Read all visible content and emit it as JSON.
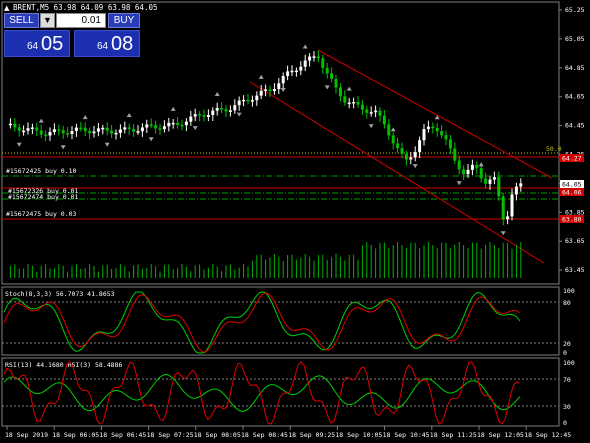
{
  "header": {
    "symbol_line": "BRENT,M5  63.98 64.09 63.98 64.05"
  },
  "trade_panel": {
    "sell_label": "SELL",
    "buy_label": "BUY",
    "lot_value": "0.01",
    "step_symbol": "▼",
    "sell_price_small": "64",
    "sell_price_big": "05",
    "buy_price_small": "64",
    "buy_price_big": "08"
  },
  "orders": [
    {
      "label": "#15672425 buy 0.10"
    },
    {
      "label": "#15672326 buy 0.01"
    },
    {
      "label": "#15672474 buy 0.01"
    },
    {
      "label": "#15672475 buy 0.03"
    }
  ],
  "levels": {
    "fib_label": "50.0",
    "tag_1": "64.27",
    "tag_2": "64.05",
    "tag_3": "64.06",
    "tag_4": "63.80"
  },
  "price_axis": [
    "65.25",
    "65.05",
    "64.85",
    "64.65",
    "64.45",
    "64.25",
    "64.05",
    "63.85",
    "63.65",
    "63.45"
  ],
  "stoch": {
    "title": "Stoch(8,3,3) 56.7073 41.8653",
    "axis": [
      "100",
      "80",
      "20",
      "0"
    ]
  },
  "rsi": {
    "title": "RSI(13) 44.1680  RSI(3) 58.4886",
    "axis": [
      "100",
      "70",
      "30",
      "0"
    ]
  },
  "time_axis": [
    "18 Sep 2019",
    "18 Sep 06:05",
    "18 Sep 06:45",
    "18 Sep 07:25",
    "18 Sep 08:05",
    "18 Sep 08:45",
    "18 Sep 09:25",
    "18 Sep 10:05",
    "18 Sep 10:45",
    "18 Sep 11:25",
    "18 Sep 12:05",
    "18 Sep 12:45"
  ],
  "colors": {
    "bull": "#ffffff",
    "bear": "#00c000",
    "channel": "#d00000",
    "volume": "#00b000",
    "grid": "#666666",
    "fast_line": "#00d000",
    "slow_line": "#e00000"
  }
}
